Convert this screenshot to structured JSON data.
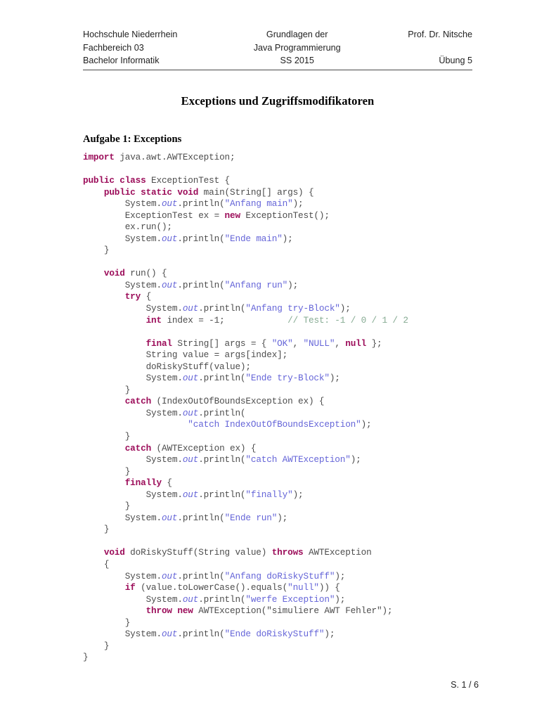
{
  "header": {
    "rows": [
      {
        "left": "Hochschule Niederrhein",
        "center": "Grundlagen der",
        "right": "Prof. Dr. Nitsche"
      },
      {
        "left": "Fachbereich 03",
        "center": "Java Programmierung",
        "right": ""
      },
      {
        "left": "Bachelor Informatik",
        "center": "SS 2015",
        "right": "Übung 5"
      }
    ]
  },
  "title": "Exceptions und Zugriffsmodifikatoren",
  "section": {
    "heading": "Aufgabe 1: Exceptions"
  },
  "colors": {
    "keyword": "#9c0d5a",
    "string": "#6565d8",
    "field": "#6565d8",
    "comment": "#86ab93",
    "plain": "#4d4d4d",
    "rule": "#4a4a4a"
  },
  "code": {
    "language": "java",
    "lines": [
      [
        {
          "t": "import",
          "c": "kw"
        },
        {
          "t": " java.awt.AWTException;",
          "c": "pl"
        }
      ],
      [],
      [
        {
          "t": "public class",
          "c": "kw"
        },
        {
          "t": " ExceptionTest {",
          "c": "pl"
        }
      ],
      [
        {
          "t": "    ",
          "c": "pl"
        },
        {
          "t": "public static void",
          "c": "kw"
        },
        {
          "t": " main(String[] args) {",
          "c": "pl"
        }
      ],
      [
        {
          "t": "        System.",
          "c": "pl"
        },
        {
          "t": "out",
          "c": "fld"
        },
        {
          "t": ".println(",
          "c": "pl"
        },
        {
          "t": "\"Anfang main\"",
          "c": "str"
        },
        {
          "t": ");",
          "c": "pl"
        }
      ],
      [
        {
          "t": "        ExceptionTest ex = ",
          "c": "pl"
        },
        {
          "t": "new",
          "c": "kw"
        },
        {
          "t": " ExceptionTest();",
          "c": "pl"
        }
      ],
      [
        {
          "t": "        ex.run();",
          "c": "pl"
        }
      ],
      [
        {
          "t": "        System.",
          "c": "pl"
        },
        {
          "t": "out",
          "c": "fld"
        },
        {
          "t": ".println(",
          "c": "pl"
        },
        {
          "t": "\"Ende main\"",
          "c": "str"
        },
        {
          "t": ");",
          "c": "pl"
        }
      ],
      [
        {
          "t": "    }",
          "c": "pl"
        }
      ],
      [],
      [
        {
          "t": "    ",
          "c": "pl"
        },
        {
          "t": "void",
          "c": "kw"
        },
        {
          "t": " run() {",
          "c": "pl"
        }
      ],
      [
        {
          "t": "        System.",
          "c": "pl"
        },
        {
          "t": "out",
          "c": "fld"
        },
        {
          "t": ".println(",
          "c": "pl"
        },
        {
          "t": "\"Anfang run\"",
          "c": "str"
        },
        {
          "t": ");",
          "c": "pl"
        }
      ],
      [
        {
          "t": "        ",
          "c": "pl"
        },
        {
          "t": "try",
          "c": "kw"
        },
        {
          "t": " {",
          "c": "pl"
        }
      ],
      [
        {
          "t": "            System.",
          "c": "pl"
        },
        {
          "t": "out",
          "c": "fld"
        },
        {
          "t": ".println(",
          "c": "pl"
        },
        {
          "t": "\"Anfang try-Block\"",
          "c": "str"
        },
        {
          "t": ");",
          "c": "pl"
        }
      ],
      [
        {
          "t": "            ",
          "c": "pl"
        },
        {
          "t": "int",
          "c": "kw"
        },
        {
          "t": " index = -1;            ",
          "c": "pl"
        },
        {
          "t": "// Test: -1 / 0 / 1 / 2",
          "c": "cmt"
        }
      ],
      [],
      [
        {
          "t": "            ",
          "c": "pl"
        },
        {
          "t": "final",
          "c": "kw"
        },
        {
          "t": " String[] args = { ",
          "c": "pl"
        },
        {
          "t": "\"OK\"",
          "c": "str"
        },
        {
          "t": ", ",
          "c": "pl"
        },
        {
          "t": "\"NULL\"",
          "c": "str"
        },
        {
          "t": ", ",
          "c": "pl"
        },
        {
          "t": "null",
          "c": "kw"
        },
        {
          "t": " };",
          "c": "pl"
        }
      ],
      [
        {
          "t": "            String value = args[index];",
          "c": "pl"
        }
      ],
      [
        {
          "t": "            doRiskyStuff(value);",
          "c": "pl"
        }
      ],
      [
        {
          "t": "            System.",
          "c": "pl"
        },
        {
          "t": "out",
          "c": "fld"
        },
        {
          "t": ".println(",
          "c": "pl"
        },
        {
          "t": "\"Ende try-Block\"",
          "c": "str"
        },
        {
          "t": ");",
          "c": "pl"
        }
      ],
      [
        {
          "t": "        }",
          "c": "pl"
        }
      ],
      [
        {
          "t": "        ",
          "c": "pl"
        },
        {
          "t": "catch",
          "c": "kw"
        },
        {
          "t": " (IndexOutOfBoundsException ex) {",
          "c": "pl"
        }
      ],
      [
        {
          "t": "            System.",
          "c": "pl"
        },
        {
          "t": "out",
          "c": "fld"
        },
        {
          "t": ".println(",
          "c": "pl"
        }
      ],
      [
        {
          "t": "                    ",
          "c": "pl"
        },
        {
          "t": "\"catch IndexOutOfBoundsException\"",
          "c": "str"
        },
        {
          "t": ");",
          "c": "pl"
        }
      ],
      [
        {
          "t": "        }",
          "c": "pl"
        }
      ],
      [
        {
          "t": "        ",
          "c": "pl"
        },
        {
          "t": "catch",
          "c": "kw"
        },
        {
          "t": " (AWTException ex) {",
          "c": "pl"
        }
      ],
      [
        {
          "t": "            System.",
          "c": "pl"
        },
        {
          "t": "out",
          "c": "fld"
        },
        {
          "t": ".println(",
          "c": "pl"
        },
        {
          "t": "\"catch AWTException\"",
          "c": "str"
        },
        {
          "t": ");",
          "c": "pl"
        }
      ],
      [
        {
          "t": "        }",
          "c": "pl"
        }
      ],
      [
        {
          "t": "        ",
          "c": "pl"
        },
        {
          "t": "finally",
          "c": "kw"
        },
        {
          "t": " {",
          "c": "pl"
        }
      ],
      [
        {
          "t": "            System.",
          "c": "pl"
        },
        {
          "t": "out",
          "c": "fld"
        },
        {
          "t": ".println(",
          "c": "pl"
        },
        {
          "t": "\"finally\"",
          "c": "str"
        },
        {
          "t": ");",
          "c": "pl"
        }
      ],
      [
        {
          "t": "        }",
          "c": "pl"
        }
      ],
      [
        {
          "t": "        System.",
          "c": "pl"
        },
        {
          "t": "out",
          "c": "fld"
        },
        {
          "t": ".println(",
          "c": "pl"
        },
        {
          "t": "\"Ende run\"",
          "c": "str"
        },
        {
          "t": ");",
          "c": "pl"
        }
      ],
      [
        {
          "t": "    }",
          "c": "pl"
        }
      ],
      [],
      [
        {
          "t": "    ",
          "c": "pl"
        },
        {
          "t": "void",
          "c": "kw"
        },
        {
          "t": " doRiskyStuff(String value) ",
          "c": "pl"
        },
        {
          "t": "throws",
          "c": "kw"
        },
        {
          "t": " AWTException",
          "c": "pl"
        }
      ],
      [
        {
          "t": "    {",
          "c": "pl"
        }
      ],
      [
        {
          "t": "        System.",
          "c": "pl"
        },
        {
          "t": "out",
          "c": "fld"
        },
        {
          "t": ".println(",
          "c": "pl"
        },
        {
          "t": "\"Anfang doRiskyStuff\"",
          "c": "str"
        },
        {
          "t": ");",
          "c": "pl"
        }
      ],
      [
        {
          "t": "        ",
          "c": "pl"
        },
        {
          "t": "if",
          "c": "kw"
        },
        {
          "t": " (value.toLowerCase().equals(",
          "c": "pl"
        },
        {
          "t": "\"null\"",
          "c": "str"
        },
        {
          "t": ")) {",
          "c": "pl"
        }
      ],
      [
        {
          "t": "            System.",
          "c": "pl"
        },
        {
          "t": "out",
          "c": "fld"
        },
        {
          "t": ".println(",
          "c": "pl"
        },
        {
          "t": "\"werfe Exception\"",
          "c": "str"
        },
        {
          "t": ");",
          "c": "pl"
        }
      ],
      [
        {
          "t": "            ",
          "c": "pl"
        },
        {
          "t": "throw new",
          "c": "kw"
        },
        {
          "t": " AWTException(\"simuliere AWT Fehler\");",
          "c": "pl"
        }
      ],
      [
        {
          "t": "        }",
          "c": "pl"
        }
      ],
      [
        {
          "t": "        System.",
          "c": "pl"
        },
        {
          "t": "out",
          "c": "fld"
        },
        {
          "t": ".println(",
          "c": "pl"
        },
        {
          "t": "\"Ende doRiskyStuff\"",
          "c": "str"
        },
        {
          "t": ");",
          "c": "pl"
        }
      ],
      [
        {
          "t": "    }",
          "c": "pl"
        }
      ],
      [
        {
          "t": "}",
          "c": "pl"
        }
      ]
    ]
  },
  "footer": {
    "page_label": "S. 1 / 6"
  }
}
